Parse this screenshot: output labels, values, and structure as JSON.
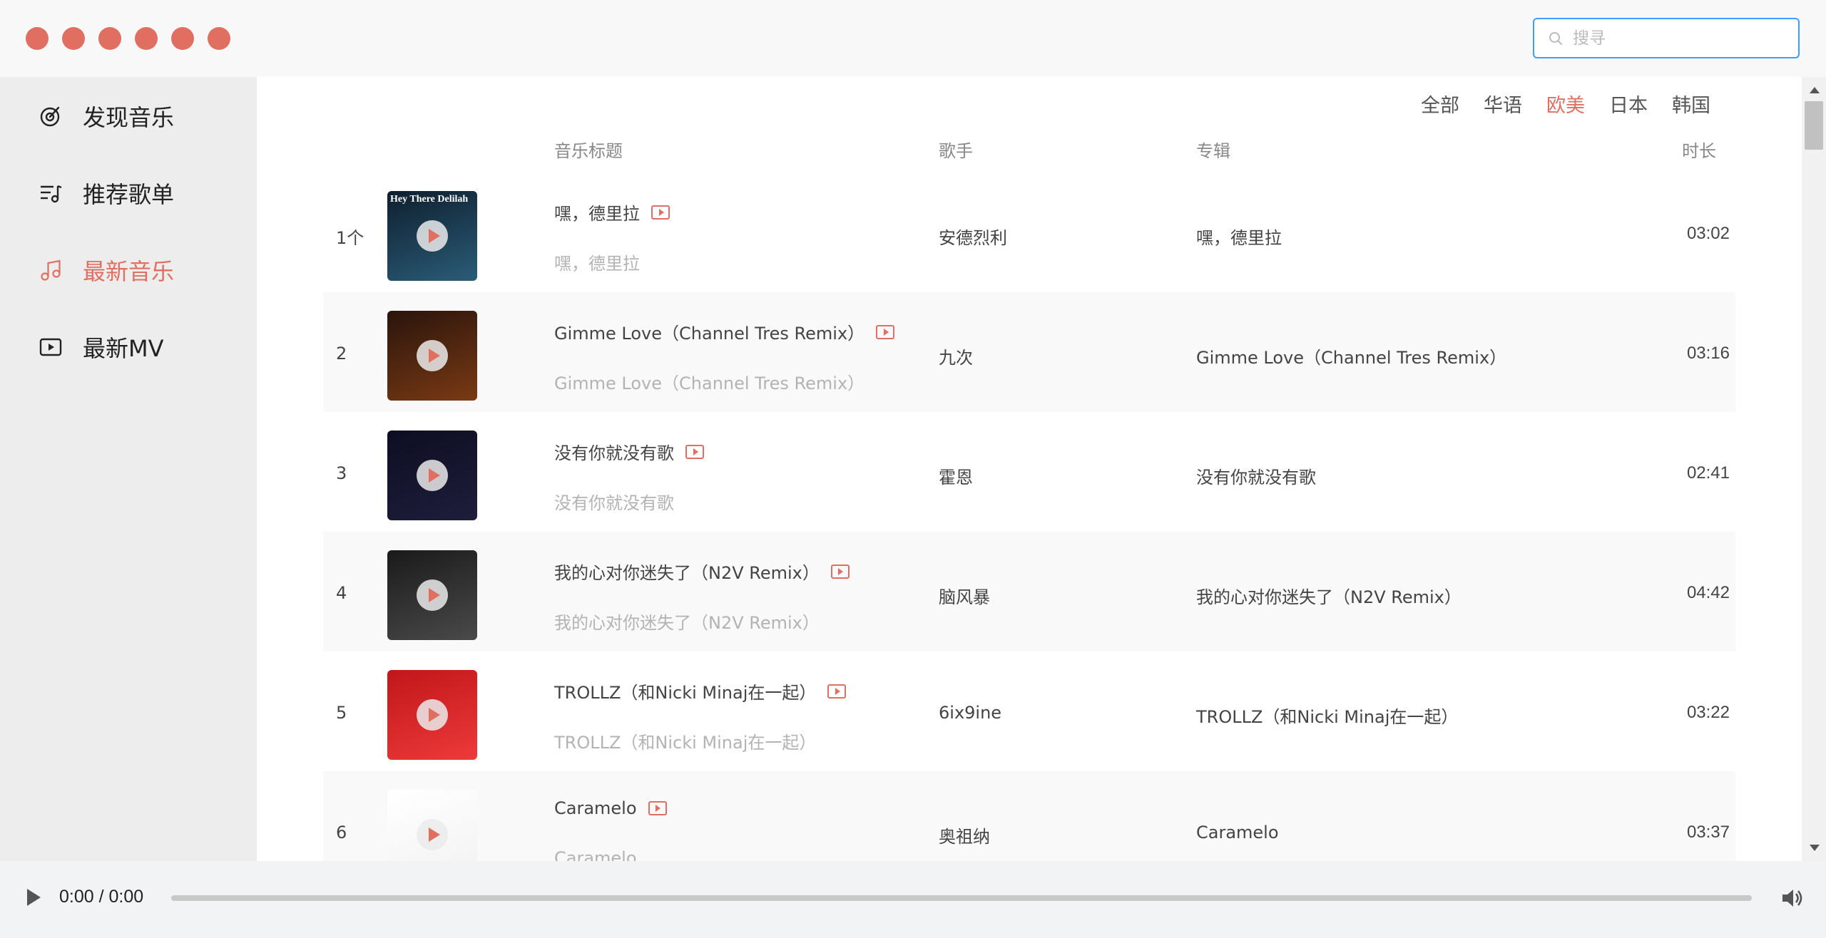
{
  "window": {
    "dots": [
      "#e06f61",
      "#e06f61",
      "#e06f61",
      "#e06f61",
      "#e06f61",
      "#e06f61"
    ]
  },
  "search": {
    "placeholder": "搜寻",
    "value": ""
  },
  "sidebar": {
    "items": [
      {
        "label": "发现音乐",
        "icon": "discover-icon",
        "active": false
      },
      {
        "label": "推荐歌单",
        "icon": "playlist-icon",
        "active": false
      },
      {
        "label": "最新音乐",
        "icon": "music-note-icon",
        "active": true
      },
      {
        "label": "最新MV",
        "icon": "video-play-icon",
        "active": false
      }
    ]
  },
  "tabs": [
    {
      "label": "全部",
      "active": false
    },
    {
      "label": "华语",
      "active": false
    },
    {
      "label": "欧美",
      "active": true
    },
    {
      "label": "日本",
      "active": false
    },
    {
      "label": "韩国",
      "active": false
    }
  ],
  "table": {
    "headers": {
      "title": "音乐标题",
      "artist": "歌手",
      "album": "专辑",
      "duration": "时长"
    },
    "rows": [
      {
        "index": "1个",
        "title": "嘿，德里拉",
        "subtitle": "嘿，德里拉",
        "artist": "安德烈利",
        "album": "嘿，德里拉",
        "duration": "03:02",
        "cover_text": "Hey There Delilah",
        "cover_colors": [
          "#0e1f2e",
          "#2b5c78"
        ]
      },
      {
        "index": "2",
        "title": "Gimme Love（Channel Tres Remix）",
        "subtitle": "Gimme Love（Channel Tres Remix）",
        "artist": "九次",
        "album": "Gimme Love（Channel Tres Remix）",
        "duration": "03:16",
        "cover_text": "",
        "cover_colors": [
          "#2a140c",
          "#7a3a14"
        ]
      },
      {
        "index": "3",
        "title": "没有你就没有歌",
        "subtitle": "没有你就没有歌",
        "artist": "霍恩",
        "album": "没有你就没有歌",
        "duration": "02:41",
        "cover_text": "",
        "cover_colors": [
          "#0d0d22",
          "#1e1e3c"
        ]
      },
      {
        "index": "4",
        "title": "我的心对你迷失了（N2V Remix）",
        "subtitle": "我的心对你迷失了（N2V Remix）",
        "artist": "脑风暴",
        "album": "我的心对你迷失了（N2V Remix）",
        "duration": "04:42",
        "cover_text": "",
        "cover_colors": [
          "#1a1a1a",
          "#4a4a4a"
        ]
      },
      {
        "index": "5",
        "title": "TROLLZ（和Nicki Minaj在一起）",
        "subtitle": "TROLLZ（和Nicki Minaj在一起）",
        "artist": "6ix9ine",
        "album": "TROLLZ（和Nicki Minaj在一起）",
        "duration": "03:22",
        "cover_text": "",
        "cover_colors": [
          "#c0161a",
          "#ee3a3a"
        ]
      },
      {
        "index": "6",
        "title": "Caramelo",
        "subtitle": "Caramelo",
        "artist": "奥祖纳",
        "album": "Caramelo",
        "duration": "03:37",
        "cover_text": "",
        "cover_colors": [
          "#ffffff",
          "#f2f2f2"
        ]
      }
    ]
  },
  "player": {
    "time": "0:00 / 0:00",
    "progress": 0
  },
  "colors": {
    "accent": "#e06f61",
    "search_border": "#409eff"
  }
}
